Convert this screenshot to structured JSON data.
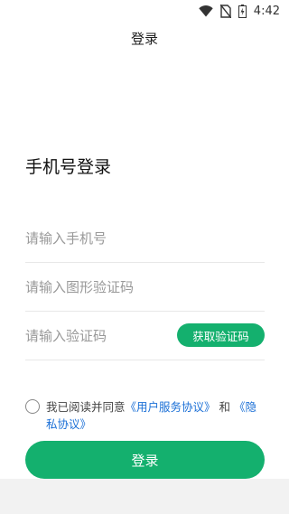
{
  "status_bar": {
    "time": "4:42",
    "icons": [
      "wifi-icon",
      "no-sim-icon",
      "battery-charging-icon"
    ]
  },
  "nav": {
    "title": "登录"
  },
  "heading": "手机号登录",
  "form": {
    "phone_placeholder": "请输入手机号",
    "captcha_placeholder": "请输入图形验证码",
    "code_placeholder": "请输入验证码",
    "get_code_label": "获取验证码"
  },
  "agreement": {
    "prefix": "我已阅读并同意",
    "user_agreement": "《用户服务协议》",
    "joiner": "和",
    "privacy_policy": "《隐私协议》",
    "checked": false
  },
  "login_button": "登录",
  "colors": {
    "accent": "#14b06e",
    "link": "#1a6fd6"
  }
}
